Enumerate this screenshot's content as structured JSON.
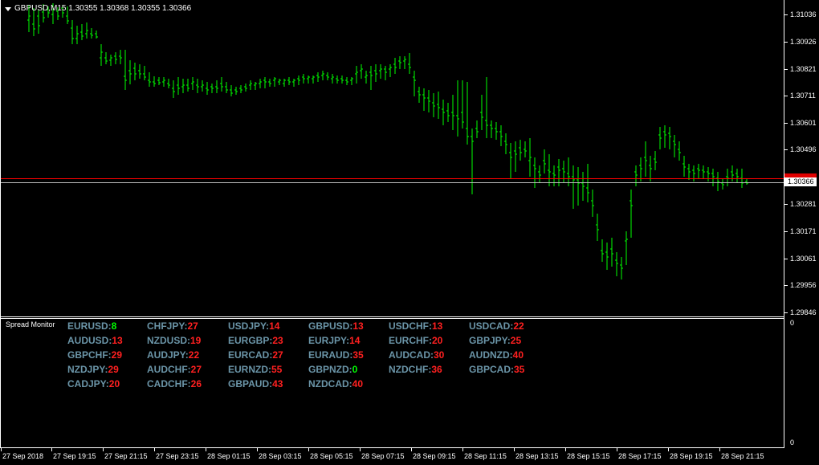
{
  "chart": {
    "title": "GBPUSD,M15  1.30355 1.30368 1.30355 1.30366",
    "bar_color": "#00ff00",
    "bid_line_color": "#c0c0c0",
    "ask_line_color": "#ff0000",
    "current_price": "1.30366"
  },
  "price_axis": [
    "1.31036",
    "1.30926",
    "1.30821",
    "1.30711",
    "1.30601",
    "1.30496",
    "1.30281",
    "1.30171",
    "1.30061",
    "1.29956",
    "1.29846"
  ],
  "time_axis": [
    "27 Sep 2018",
    "27 Sep 19:15",
    "27 Sep 21:15",
    "27 Sep 23:15",
    "28 Sep 01:15",
    "28 Sep 03:15",
    "28 Sep 05:15",
    "28 Sep 07:15",
    "28 Sep 09:15",
    "28 Sep 11:15",
    "28 Sep 13:15",
    "28 Sep 15:15",
    "28 Sep 17:15",
    "28 Sep 19:15",
    "28 Sep 21:15"
  ],
  "indicator": {
    "name": "Spread Monitor",
    "scale_top": "0",
    "scale_bottom": "0",
    "columns": [
      [
        {
          "sym": "EURUSD:",
          "val": "8",
          "color": "#00ff00"
        },
        {
          "sym": "AUDUSD:",
          "val": "13",
          "color": "#ff2020"
        },
        {
          "sym": "GBPCHF:",
          "val": "29",
          "color": "#ff2020"
        },
        {
          "sym": "NZDJPY:",
          "val": "29",
          "color": "#ff2020"
        },
        {
          "sym": "CADJPY:",
          "val": "20",
          "color": "#ff2020"
        }
      ],
      [
        {
          "sym": "CHFJPY:",
          "val": "27",
          "color": "#ff2020"
        },
        {
          "sym": "NZDUSD:",
          "val": "19",
          "color": "#ff2020"
        },
        {
          "sym": "AUDJPY:",
          "val": "22",
          "color": "#ff2020"
        },
        {
          "sym": "AUDCHF:",
          "val": "27",
          "color": "#ff2020"
        },
        {
          "sym": "CADCHF:",
          "val": "26",
          "color": "#ff2020"
        }
      ],
      [
        {
          "sym": "USDJPY:",
          "val": "14",
          "color": "#ff2020"
        },
        {
          "sym": "EURGBP:",
          "val": "23",
          "color": "#ff2020"
        },
        {
          "sym": "EURCAD:",
          "val": "27",
          "color": "#ff2020"
        },
        {
          "sym": "EURNZD:",
          "val": "55",
          "color": "#ff2020"
        },
        {
          "sym": "GBPAUD:",
          "val": "43",
          "color": "#ff2020"
        }
      ],
      [
        {
          "sym": "GBPUSD:",
          "val": "13",
          "color": "#ff2020"
        },
        {
          "sym": "EURJPY:",
          "val": "14",
          "color": "#ff2020"
        },
        {
          "sym": "EURAUD:",
          "val": "35",
          "color": "#ff2020"
        },
        {
          "sym": "GBPNZD:",
          "val": "0",
          "color": "#00ff00"
        },
        {
          "sym": "NZDCAD:",
          "val": "40",
          "color": "#ff2020"
        }
      ],
      [
        {
          "sym": "USDCHF:",
          "val": "13",
          "color": "#ff2020"
        },
        {
          "sym": "EURCHF:",
          "val": "20",
          "color": "#ff2020"
        },
        {
          "sym": "AUDCAD:",
          "val": "30",
          "color": "#ff2020"
        },
        {
          "sym": "NZDCHF:",
          "val": "36",
          "color": "#ff2020"
        }
      ],
      [
        {
          "sym": "USDCAD:",
          "val": "22",
          "color": "#ff2020"
        },
        {
          "sym": "GBPJPY:",
          "val": "25",
          "color": "#ff2020"
        },
        {
          "sym": "AUDNZD:",
          "val": "40",
          "color": "#ff2020"
        },
        {
          "sym": "GBPCAD:",
          "val": "35",
          "color": "#ff2020"
        }
      ]
    ]
  }
}
